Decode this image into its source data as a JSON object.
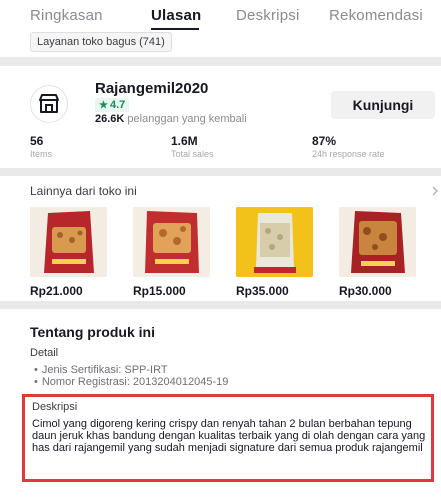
{
  "tabs": [
    {
      "label": "Ringkasan",
      "active": false
    },
    {
      "label": "Ulasan",
      "active": true
    },
    {
      "label": "Deskripsi",
      "active": false
    },
    {
      "label": "Rekomendasi",
      "active": false
    }
  ],
  "review_chip": "Layanan toko bagus (741)",
  "shop": {
    "name": "Rajangemil2020",
    "rating": "4.7",
    "returning_count": "26.6K",
    "returning_label": "pelanggan yang kembali",
    "visit_label": "Kunjungi",
    "logo_icon": "storefront-icon",
    "stats": [
      {
        "value": "56",
        "label": "Items"
      },
      {
        "value": "1.6M",
        "label": "Total sales"
      },
      {
        "value": "87%",
        "label": "24h response rate"
      }
    ]
  },
  "more_from_shop": {
    "title": "Lainnya dari toko ini",
    "products": [
      {
        "price": "Rp21.000",
        "package": "red bag",
        "accent": "#b7262b"
      },
      {
        "price": "Rp15.000",
        "package": "red bag",
        "accent": "#c02e2f"
      },
      {
        "price": "Rp35.000",
        "package": "yellow pouch",
        "accent": "#f2c21a"
      },
      {
        "price": "Rp30.000",
        "package": "red bag",
        "accent": "#a82225"
      }
    ]
  },
  "about": {
    "title": "Tentang produk ini",
    "detail_label": "Detail",
    "details": [
      "Jenis Sertifikasi: SPP-IRT",
      "Nomor Registrasi: 2013204012045-19"
    ],
    "description_label": "Deskripsi",
    "description": "Cimol yang digoreng kering crispy dan renyah tahan 2 bulan berbahan tepung  daun jeruk khas bandung dengan kualitas terbaik yang di olah dengan cara yang has dari rajangemil yang sudah menjadi signature dari semua produk rajangemil",
    "highlight_color": "#e0383f"
  }
}
